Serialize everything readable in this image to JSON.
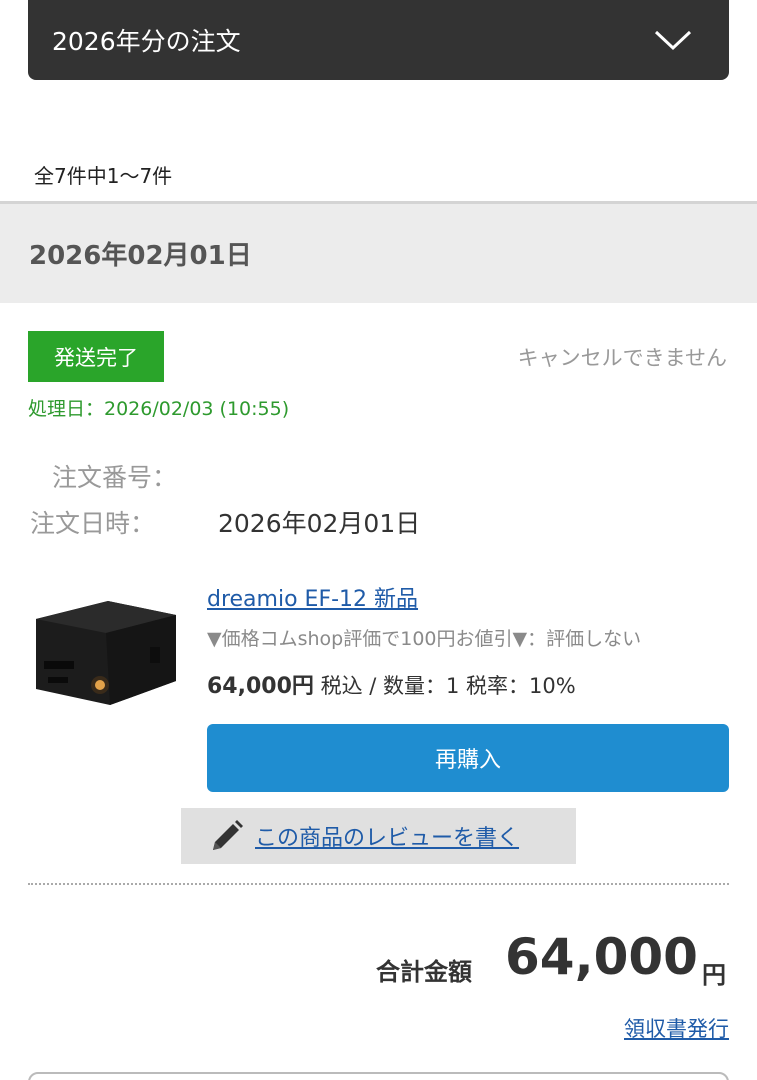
{
  "year_select": {
    "label": "2026年分の注文",
    "icon": "chevron-down-icon"
  },
  "summary": {
    "count_text": "全7件中1〜7件"
  },
  "order": {
    "date_header": "2026年02月01日",
    "status": {
      "label": "発送完了",
      "color": "#2aa52a"
    },
    "cancel_note": "キャンセルできません",
    "processed": "処理日：2026/02/03 (10:55)",
    "order_number_label": "注文番号：",
    "order_date_label": "注文日時：",
    "order_date_value": "2026年02月01日",
    "item": {
      "image": "projector-image",
      "name": "dreamio EF-12 新品",
      "coupon": "▼価格コムshop評価で100円お値引▼：評価しない",
      "price": "64,000円",
      "price_detail": " 税込 / 数量：1 税率：10%"
    },
    "rebuy_label": "再購入",
    "review_label": "この商品のレビューを書く",
    "total_label": "合計金額",
    "total_amount": "64,000",
    "total_unit": "円",
    "receipt_label": "領収書発行"
  },
  "colors": {
    "link": "#1f5ba8",
    "button": "#1f8dd0",
    "status": "#2aa52a"
  }
}
